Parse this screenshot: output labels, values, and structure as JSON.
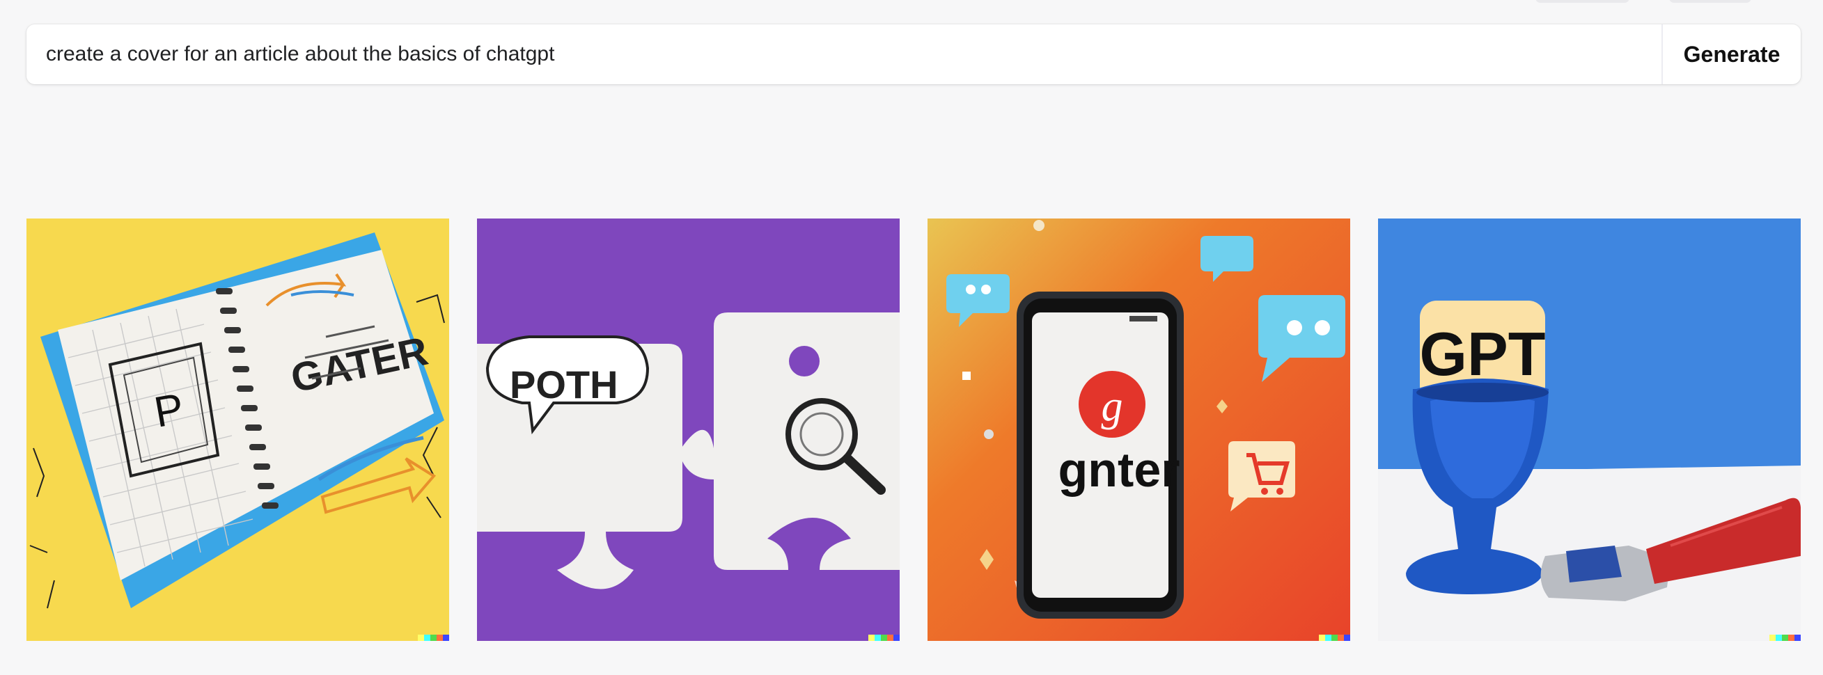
{
  "prompt": {
    "value": "create a cover for an article about the basics of chatgpt",
    "generate_label": "Generate"
  },
  "images": [
    {
      "text": [
        "P",
        "GATER"
      ]
    },
    {
      "text": [
        "POTH"
      ]
    },
    {
      "text": [
        "gnter",
        "g"
      ]
    },
    {
      "text": [
        "GPT"
      ]
    }
  ],
  "signature_colors": [
    "#ffff66",
    "#42ffff",
    "#51da4c",
    "#ff6e3c",
    "#3c46ff"
  ]
}
